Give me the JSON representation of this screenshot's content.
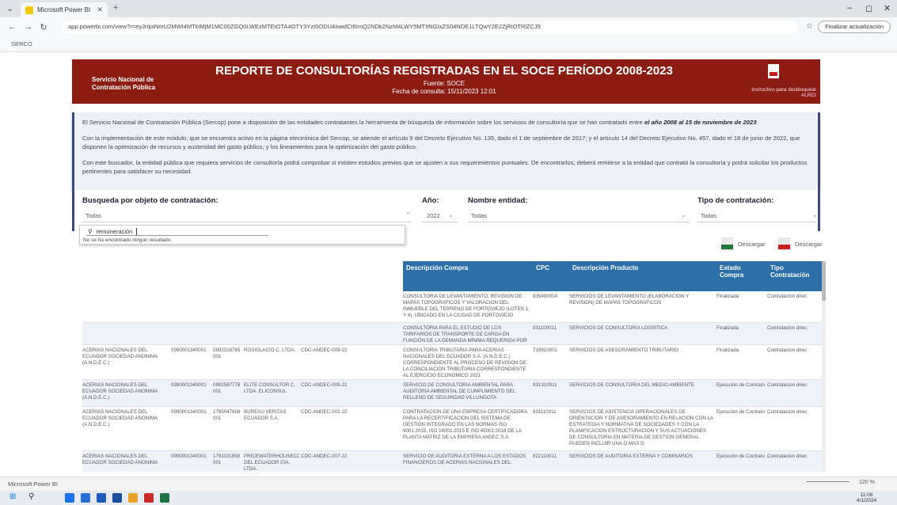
{
  "browser": {
    "tab_title": "Microsoft Power BI",
    "url": "app.powerbi.com/view?r=eyJrIjoiNmU2MWI4MTktMjM1MC00ZGQ0LWEzMTEtOTA4OTY3YzI0ODU4IiwidCI6ImQ2NDk2NzM4LWY5MTItNGIxZS04NDE1LTQwY2E2ZjRiOTRlZCJ9",
    "update_label": "Finalizar actualización",
    "bookmark": "SERCO"
  },
  "report": {
    "org_name": "Servicio Nacional de Contratación Pública",
    "title": "REPORTE DE CONSULTORÍAS REGISTRADAS EN EL SOCE PERÍODO 2008-2023",
    "source": "Fuente: SOCE",
    "query_date": "Fecha de consulta: 15/11/2023 12:01",
    "instructions": "instructivo para desbloquear ALRCI"
  },
  "info": {
    "p1_text": "El Servicio Nacional de Contratación Pública (Sercop) pone a disposición de las entidades contratantes la herramienta de búsqueda de información sobre los servicios de consultoría que se han contratado entre ",
    "p1_bold": "el año 2008 al 15 de noviembre de 2023",
    "p2": "Con la implementación de este módulo, que se encuentra activo en la página electrónica del Sercop, se atiende el artículo 9 del Decreto Ejecutivo No. 135, dado el 1 de septiembre de 2017; y el artículo 14 del Decreto Ejecutivo No. 457, dado el 18 de junio de 2022, que disponen la optimización de recursos y austeridad del gasto público, y los lineamientos para la optimización del gasto público.",
    "p3": "Con este buscador, la entidad pública que requiera servicios de consultoría podrá comprobar si existen estudios previos que se ajusten a sus requerimientos puntuales. De encontrarlos, deberá remitirse a la entidad que contrató la consultoría y podrá solicitar los productos pertinentes para satisfacer su necesidad."
  },
  "filters": {
    "objeto_label": "Busqueda por objeto de contratación:",
    "objeto_value": "Todas",
    "anio_label": "Año:",
    "anio_value": "2022",
    "entidad_label": "Nombre entidad:",
    "entidad_value": "Todas",
    "tipo_label": "Tipo de contratación:",
    "tipo_value": "Todas"
  },
  "dropdown": {
    "search_value": "remuneración",
    "no_results": "No se ha encontrado ningún resultado."
  },
  "downloads": {
    "excel_label": "Descargar",
    "pdf_label": "Descargar"
  },
  "table": {
    "headers": [
      "Descripción Compra",
      "CPC",
      "Descripción Producto",
      "Estado Compra",
      "Tipo Contratación"
    ],
    "rows": [
      {
        "entidad": "",
        "ruc": "",
        "ruc_prov": "",
        "proveedor": "",
        "codigo": "",
        "desc": "CONSULTORIA DE LEVANTAMIENTO, REVISION DE MAPAS TOPOGRAFICOS Y VALORACION DEL INMUEBLE DEL TERRENO DE PORTOVIEJO (LOTES 1, Y 4), UBICADO EN LA CIUDAD DE PORTOVIEJO",
        "cpc": "835400014",
        "producto": "SERVICIOS DE LEVANTAMIENTO (ELABORACION Y REVISION) DE MAPAS TOPOGRAFICOS",
        "estado": "Finalizada",
        "tipo": "Contratacion direc"
      },
      {
        "entidad": "",
        "ruc": "",
        "ruc_prov": "",
        "proveedor": "",
        "codigo": "",
        "desc": "CONSULTORIA PARA EL ESTUDIO DE LOS TARIFARIOS DE TRANSPORTE DE CARGA EN FUNCIÓN DE LA DEMANDA MÍNIMA REQUERIDA POR ANDEC S.A",
        "cpc": "831100011",
        "producto": "SERVICIOS DE CONSULTORIA LOGISTICA",
        "estado": "Finalizada",
        "tipo": "Contratacion direc"
      },
      {
        "entidad": "ACERIAS NACIONALES DEL ECUADOR SOCIEDAD ANONIMA (A.N.D.E.C.)",
        "ruc": "0990001340001",
        "ruc_prov": "0992316765 001",
        "proveedor": "ROSIGLACIO C. LTDA.",
        "codigo": "CDC-ANDEC-009-22",
        "desc": "CONSULTORIA TRIBUTARIA PARA ACERIAS NACIONALES DEL ECUADOR S.A. (A.N.D.E.C.) CORRESPONDIENTE AL PROCESO DE REVISION DE LA CONCILIACION TRIBUTARIA CORRESPONDIENTE AL EJERCICIO ECONOMICO 2021",
        "cpc": "719910001",
        "producto": "SERVICIOS DE ASESORAMIENTO TRIBUTARIO",
        "estado": "Finalizada",
        "tipo": "Contratacion direc"
      },
      {
        "entidad": "ACERIAS NACIONALES DEL ECUADOR SOCIEDAD ANONIMA (A.N.D.E.C.)",
        "ruc": "0990001340001",
        "ruc_prov": "0992587778 001",
        "proveedor": "ELITE CONSULTOR C. LTDA. ELICONSUL",
        "codigo": "CDC-ANDEC-009-22",
        "desc": "SERVICIO DE CONSULTORIA AMBIENTAL PARA AUDITORIA AMBIENTAL DE CUMPLIMIENTO DEL RELLENO DE SEGURIDAD VILLUNGOTA",
        "cpc": "831310011",
        "producto": "SERVICIOS DE CONSULTORIA DEL MEDIO AMBIENTE",
        "estado": "Ejecución de Contrato",
        "tipo": "Contratacion direc"
      },
      {
        "entidad": "ACERIAS NACIONALES DEL ECUADOR SOCIEDAD ANONIMA (A.N.D.E.C.)",
        "ruc": "0990001340001",
        "ruc_prov": "1790047606 001",
        "proveedor": "BUREAU VERITAS ECUADOR S.A.",
        "codigo": "CDC-ANDEC-002-22",
        "desc": "CONTRATACION DE UNA EMPRESA CERTIFICADORA PARA LA RECERTIFICACION DEL SISTEMA DE GESTION INTEGRADO EN LAS NORMAS ISO 9001:2015, ISO 14001:2015 E ISO 45001:2018 DE LA PLANTA MATRIZ DE LA EMPRESA ANDEC S.A.",
        "cpc": "831110011",
        "producto": "SERVICIOS DE ASISTENCIA OPERACIONALES DE ORIENTACION Y DE ASESORAMIENTO EN RELACION CON LA ESTRATEGIA Y NORMATIVA DE SOCIEDADES Y CON LA PLANIFICACION ESTRUCTURACION Y SUS ACTUACIONES DE CONSULTORIA EN MATERIA DE GESTION GENERAL PUEDEN INCLUIR UNA O MAS D",
        "estado": "Ejecución de Contrato",
        "tipo": "Contratacion direc"
      },
      {
        "entidad": "ACERIAS NACIONALES DEL ECUADOR SOCIEDAD ANONIMA",
        "ruc": "0990001340001",
        "ruc_prov": "1791101858 001",
        "proveedor": "PRICEWATERHOUSECOOPERS DEL ECUADOR CIA. LTDA.",
        "codigo": "CDC-ANDEC-007-22",
        "desc": "SERVICIO DE AUDITORIA EXTERNA A LOS ESTADOS FINANCIEROS DE ACERIAS NACIONALES DEL",
        "cpc": "822110011",
        "producto": "SERVICIOS DE AUDITORIA EXTERNA Y COMISARIOS",
        "estado": "Ejecución de Contrato",
        "tipo": "Contratacion direc"
      }
    ]
  },
  "status": {
    "app_name": "Microsoft Power BI",
    "zoom": "120 %"
  },
  "taskbar": {
    "time": "11:08",
    "date": "4/1/2024"
  },
  "colors": {
    "header_bg": "#8c1c12",
    "table_header": "#2d6fa8",
    "border_accent": "#3b4a7a"
  }
}
